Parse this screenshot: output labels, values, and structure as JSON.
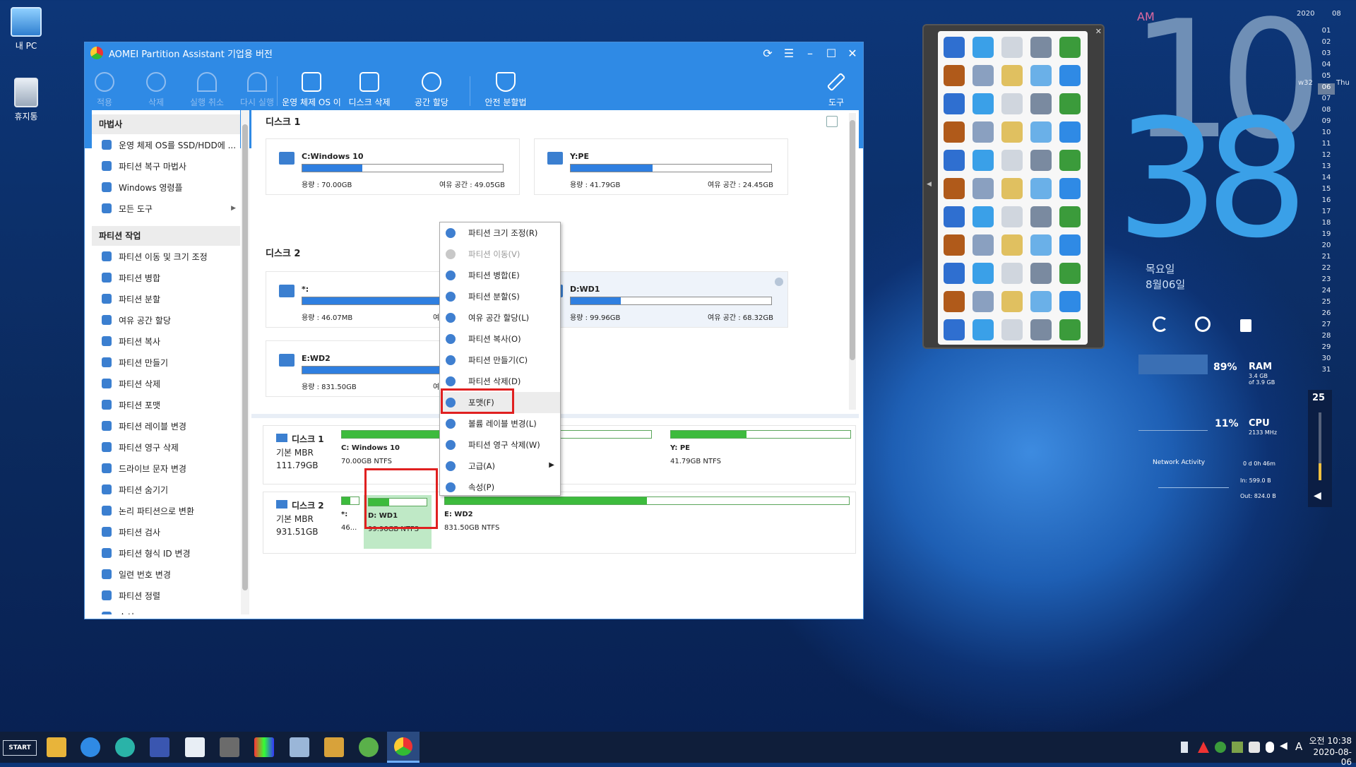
{
  "desktop": {
    "icons": [
      {
        "label": "내 PC",
        "icon": "computer-icon"
      },
      {
        "label": "휴지통",
        "icon": "recycle-bin-icon"
      }
    ]
  },
  "window": {
    "title": "AOMEI Partition Assistant 기업용 버전",
    "toolbar": [
      {
        "label": "적용",
        "icon": "check-icon",
        "enabled": false
      },
      {
        "label": "삭제",
        "icon": "x-circle-icon",
        "enabled": false
      },
      {
        "label": "실행 취소",
        "icon": "undo-icon",
        "enabled": false
      },
      {
        "label": "다시 실행",
        "icon": "redo-icon",
        "enabled": false
      },
      {
        "label": "운영 체제 OS 이식",
        "icon": "migrate-os-icon",
        "enabled": true
      },
      {
        "label": "디스크 삭제",
        "icon": "wipe-disk-icon",
        "enabled": true
      },
      {
        "label": "공간 할당",
        "icon": "allocate-space-icon",
        "enabled": true
      },
      {
        "label": "안전 분할법",
        "icon": "shield-icon",
        "enabled": true
      },
      {
        "label": "도구",
        "icon": "wrench-icon",
        "enabled": true
      }
    ],
    "sidebar": {
      "wizard_title": "마법사",
      "wizard_items": [
        "운영 체제 OS를 SSD/HDD에 ...",
        "파티션 복구 마법사",
        "Windows 영령플",
        "모든 도구"
      ],
      "ops_title": "파티션 작업",
      "ops_items": [
        "파티션 이동 및 크기 조정",
        "파티션 병합",
        "파티션 분할",
        "여유 공간 할당",
        "파티션 복사",
        "파티션 만들기",
        "파티션 삭제",
        "파티션 포맷",
        "파티션 레이블 변경",
        "파티션 영구 삭제",
        "드라이브 문자 변경",
        "파티션 숨기기",
        "논리 파티션으로 변환",
        "파티션 검사",
        "파티션 형식 ID 변경",
        "일련 번호 변경",
        "파티션 정렬",
        "속성"
      ]
    },
    "disk1": {
      "title": "디스크 1",
      "partitions": [
        {
          "name": "C:Windows 10",
          "fill": 0.3,
          "used": "용량 : 70.00GB",
          "free": "여유 공간 : 49.05GB"
        },
        {
          "name": "Y:PE",
          "fill": 0.41,
          "used": "용량 : 41.79GB",
          "free": "여유 공간 : 24.45GB"
        }
      ]
    },
    "disk2": {
      "title": "디스크 2",
      "partitions": [
        {
          "name": "*:",
          "fill": 1.0,
          "used": "용량 : 46.07MB",
          "free": "여"
        },
        {
          "name": "D:WD1",
          "fill": 0.25,
          "used": "용량 : 99.96GB",
          "free": "여유 공간 : 68.32GB"
        },
        {
          "name": "E:WD2",
          "fill": 0.95,
          "used": "용량 : 831.50GB",
          "free": "여"
        }
      ]
    },
    "map": {
      "disk1": {
        "name": "디스크 1",
        "type": "기본 MBR",
        "size": "111.79GB",
        "parts": [
          {
            "name": "C: Windows 10",
            "fs": "70.00GB NTFS",
            "fill": 0.55
          },
          {
            "name": "Y: PE",
            "fs": "41.79GB NTFS",
            "fill": 0.42
          }
        ]
      },
      "disk2": {
        "name": "디스크 2",
        "type": "기본 MBR",
        "size": "931.51GB",
        "parts": [
          {
            "name": "*:",
            "fs": "46...",
            "fill": 0.5
          },
          {
            "name": "D: WD1",
            "fs": "99.96GB NTFS",
            "fill": 0.35
          },
          {
            "name": "E: WD2",
            "fs": "831.50GB NTFS",
            "fill": 0.5
          }
        ]
      }
    }
  },
  "context_menu": [
    {
      "label": "파티션 크기 조정(R)",
      "enabled": true
    },
    {
      "label": "파티션 이동(V)",
      "enabled": false
    },
    {
      "label": "파티션 병합(E)",
      "enabled": true
    },
    {
      "label": "파티션 분할(S)",
      "enabled": true
    },
    {
      "label": "여유 공간 할당(L)",
      "enabled": true
    },
    {
      "label": "파티션 복사(O)",
      "enabled": true
    },
    {
      "label": "파티션 만들기(C)",
      "enabled": true
    },
    {
      "label": "파티션 삭제(D)",
      "enabled": true
    },
    {
      "label": "포맷(F)",
      "enabled": true,
      "highlighted": true
    },
    {
      "label": "볼륨 레이블 변경(L)",
      "enabled": true
    },
    {
      "label": "파티션 영구 삭제(W)",
      "enabled": true
    },
    {
      "label": "고급(A)",
      "enabled": true,
      "submenu": true
    },
    {
      "label": "속성(P)",
      "enabled": true
    }
  ],
  "clock": {
    "ampm": "AM",
    "hour": "10",
    "minute": "38",
    "weekday": "목요일",
    "date": "8월06일"
  },
  "calendar": {
    "year": "2020",
    "month": "08",
    "week": "w32",
    "weekday": "Thu",
    "today": "06",
    "days": [
      "01",
      "02",
      "03",
      "04",
      "05",
      "06",
      "07",
      "08",
      "09",
      "10",
      "11",
      "12",
      "13",
      "14",
      "15",
      "16",
      "17",
      "18",
      "19",
      "20",
      "21",
      "22",
      "23",
      "24",
      "25",
      "26",
      "27",
      "28",
      "29",
      "30",
      "31"
    ]
  },
  "system": {
    "ram_pct": "89%",
    "ram_label": "RAM",
    "ram_sub1": "3.4 GB",
    "ram_sub2": "of 3.9 GB",
    "cpu_pct": "11%",
    "cpu_label": "CPU",
    "cpu_sub": "2133 MHz",
    "net_label": "Network Activity",
    "net_time": "0 d 0h 46m",
    "net_in": "In: 599.0 B",
    "net_out": "Out: 824.0 B",
    "volume": "25"
  },
  "taskbar": {
    "start": "START",
    "time": "오전 10:38",
    "date": "2020-08-06",
    "tray_letter": "A"
  },
  "colors": {
    "accent": "#2f8ae5",
    "selection_red": "#e02020",
    "partition_green": "#3dbb3d",
    "bar_blue": "#2f7fe0",
    "clock_blue": "#3aa0e8"
  }
}
